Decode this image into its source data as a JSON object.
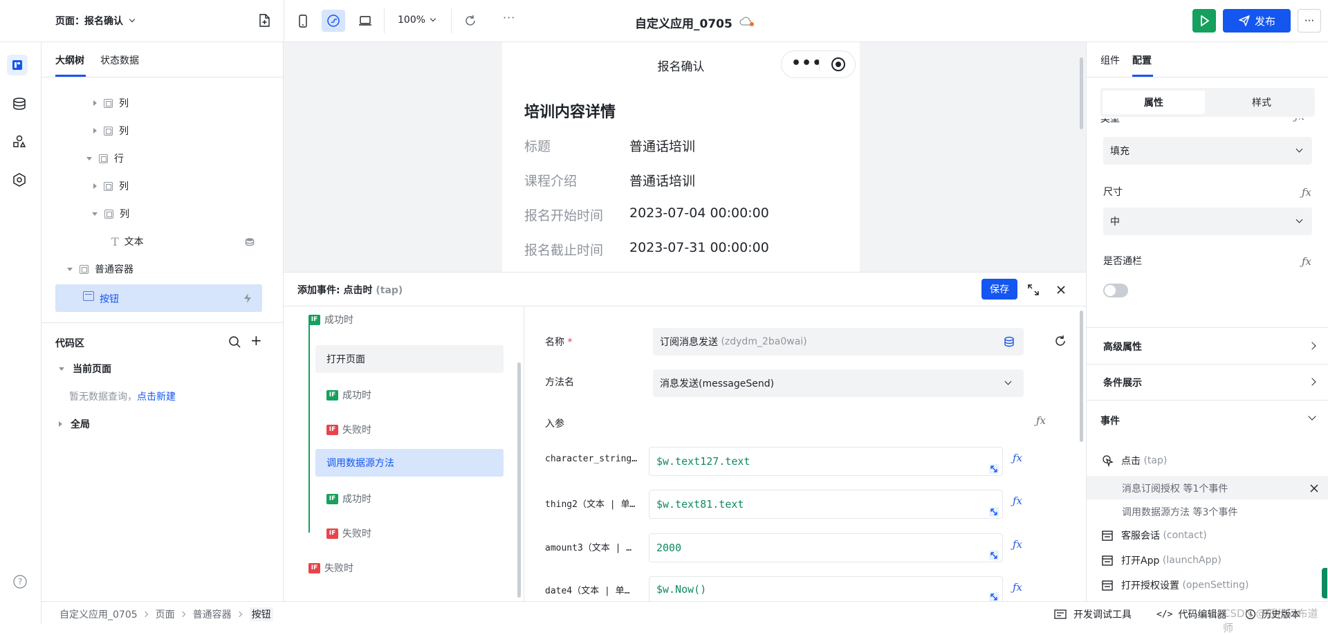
{
  "topbar": {
    "page_label": "页面：报名确认",
    "zoom": "100%",
    "app_title": "自定义应用_0705",
    "publish_label": "发布"
  },
  "left": {
    "tabs": [
      "大纲树",
      "状态数据"
    ],
    "tree": [
      {
        "label": "列"
      },
      {
        "label": "列"
      },
      {
        "label": "行"
      },
      {
        "label": "列"
      },
      {
        "label": "列"
      },
      {
        "label": "文本"
      },
      {
        "label": "普通容器"
      },
      {
        "label": "按钮"
      }
    ],
    "code_area_title": "代码区",
    "current_page": "当前页面",
    "empty_hint": "暂无数据查询，",
    "create_link": "点击新建",
    "global": "全局"
  },
  "preview": {
    "nav_title": "报名确认",
    "heading": "培训内容详情",
    "rows": [
      {
        "label": "标题",
        "value": "普通话培训"
      },
      {
        "label": "课程介绍",
        "value": "普通话培训"
      },
      {
        "label": "报名开始时间",
        "value": "2023-07-04 00:00:00"
      },
      {
        "label": "报名截止时间",
        "value": "2023-07-31 00:00:00"
      }
    ]
  },
  "event_panel": {
    "title": "添加事件: 点击时",
    "title_sub": "(tap)",
    "save_label": "保存",
    "flow": [
      {
        "tag": "IF",
        "label": "成功时",
        "tone": "green"
      },
      {
        "label": "打开页面"
      },
      {
        "tag": "IF",
        "label": "成功时",
        "tone": "green"
      },
      {
        "tag": "IF",
        "label": "失败时",
        "tone": "red"
      },
      {
        "label": "调用数据源方法"
      },
      {
        "tag": "IF",
        "label": "成功时",
        "tone": "green"
      },
      {
        "tag": "IF",
        "label": "失败时",
        "tone": "red"
      },
      {
        "tag": "IF",
        "label": "失败时",
        "tone": "red"
      }
    ],
    "name_label": "名称",
    "required_mark": "*",
    "name_value": "订阅消息发送",
    "name_value_sub": "(zdydm_2ba0wai)",
    "method_label": "方法名",
    "method_value": "消息发送(messageSend)",
    "params_label": "入参",
    "params": [
      {
        "label": "character_string…",
        "value": "$w.text127.text"
      },
      {
        "label": "thing2（文本 | 单…",
        "value": "$w.text81.text"
      },
      {
        "label": "amount3（文本 | …",
        "value": "2000"
      },
      {
        "label": "date4（文本 | 单…",
        "value": "$w.Now()"
      }
    ]
  },
  "right": {
    "tabs": [
      "组件",
      "配置"
    ],
    "seg": [
      "属性",
      "样式"
    ],
    "cut_label": "类型",
    "fill_value": "填充",
    "size_label": "尺寸",
    "size_value": "中",
    "block_label": "是否通栏",
    "advanced": "高级属性",
    "condition": "条件展示",
    "events": "事件",
    "tap_label": "点击",
    "tap_sub": "(tap)",
    "tap_item1": "消息订阅授权 等1个事件",
    "tap_item2": "调用数据源方法 等3个事件",
    "contact_label": "客服会话",
    "contact_sub": "(contact)",
    "launch_label": "打开App",
    "launch_sub": "(launchApp)",
    "setting_label": "打开授权设置",
    "setting_sub": "(openSetting)"
  },
  "statusbar": {
    "crumbs": [
      "自定义应用_0705",
      "页面",
      "普通容器",
      "按钮"
    ],
    "dev_tools": "开发调试工具",
    "code_editor": "代码编辑器",
    "history": "历史版本",
    "watermark": "CSDN @低代码布道师"
  },
  "colors": {
    "accent": "#1456f0",
    "run": "#16a05d",
    "selected": "#d6e4fc"
  }
}
